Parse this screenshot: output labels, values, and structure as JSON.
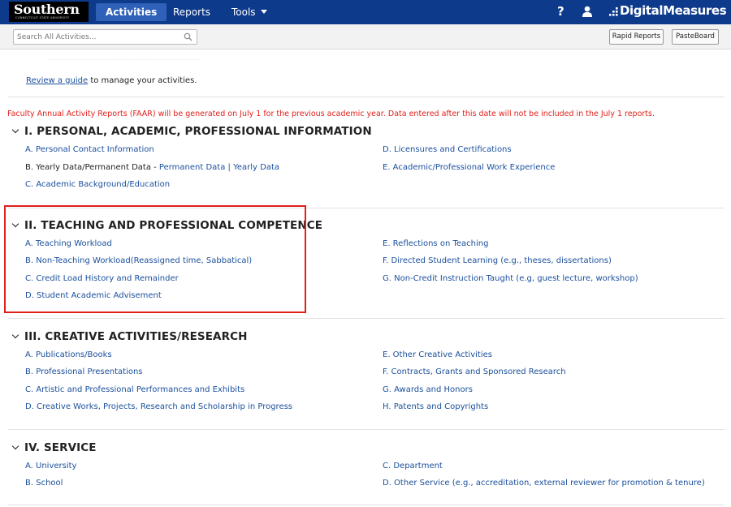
{
  "header": {
    "logo_main": "Southern",
    "logo_sub": "CONNECTICUT STATE UNIVERSITY",
    "nav": [
      {
        "label": "Activities"
      },
      {
        "label": "Reports"
      },
      {
        "label": "Tools"
      }
    ],
    "help_label": "?",
    "brand": "DigitalMeasures",
    "brand_color": "#0e3a8c",
    "active_tab_color": "#2f61b8"
  },
  "toolbar": {
    "search_placeholder": "Search All Activities...",
    "rapid_reports": "Rapid Reports",
    "pasteboard": "PasteBoard"
  },
  "guide": {
    "link": "Review a guide",
    "text": " to manage your activities."
  },
  "notice": "Faculty Annual Activity Reports (FAAR) will be generated on July 1 for the previous academic year. Data entered after this date will not be included in the July 1 reports.",
  "notice_color": "#e0201b",
  "sections": [
    {
      "title": "I. PERSONAL, ACADEMIC, PROFESSIONAL INFORMATION",
      "left": [
        "A. Personal Contact Information",
        "B. Yearly Data/Permanent Data - ",
        "C. Academic Background/Education"
      ],
      "b_links": [
        "Permanent Data",
        " | ",
        "Yearly Data"
      ],
      "right": [
        "D. Licensures and Certifications",
        "E. Academic/Professional Work Experience"
      ]
    },
    {
      "title": "II. TEACHING AND PROFESSIONAL COMPETENCE",
      "left": [
        "A. Teaching Workload",
        "B. Non-Teaching Workload(Reassigned time, Sabbatical)",
        "C. Credit Load History and Remainder",
        "D. Student Academic Advisement"
      ],
      "right": [
        "E. Reflections on Teaching",
        "F. Directed Student Learning (e.g., theses, dissertations)",
        "G. Non-Credit Instruction Taught (e.g, guest lecture, workshop)"
      ]
    },
    {
      "title": "III. CREATIVE ACTIVITIES/RESEARCH",
      "left": [
        "A. Publications/Books",
        "B. Professional Presentations",
        "C. Artistic and Professional Performances and Exhibits",
        "D. Creative Works, Projects, Research and Scholarship in Progress"
      ],
      "right": [
        "E. Other Creative Activities",
        "F. Contracts, Grants and Sponsored Research",
        "G. Awards and Honors",
        "H. Patents and Copyrights"
      ]
    },
    {
      "title": "IV. SERVICE",
      "left": [
        "A. University",
        "B. School"
      ],
      "right": [
        "C. Department",
        "D. Other Service (e.g., accreditation, external reviewer for promotion & tenure)"
      ]
    }
  ]
}
